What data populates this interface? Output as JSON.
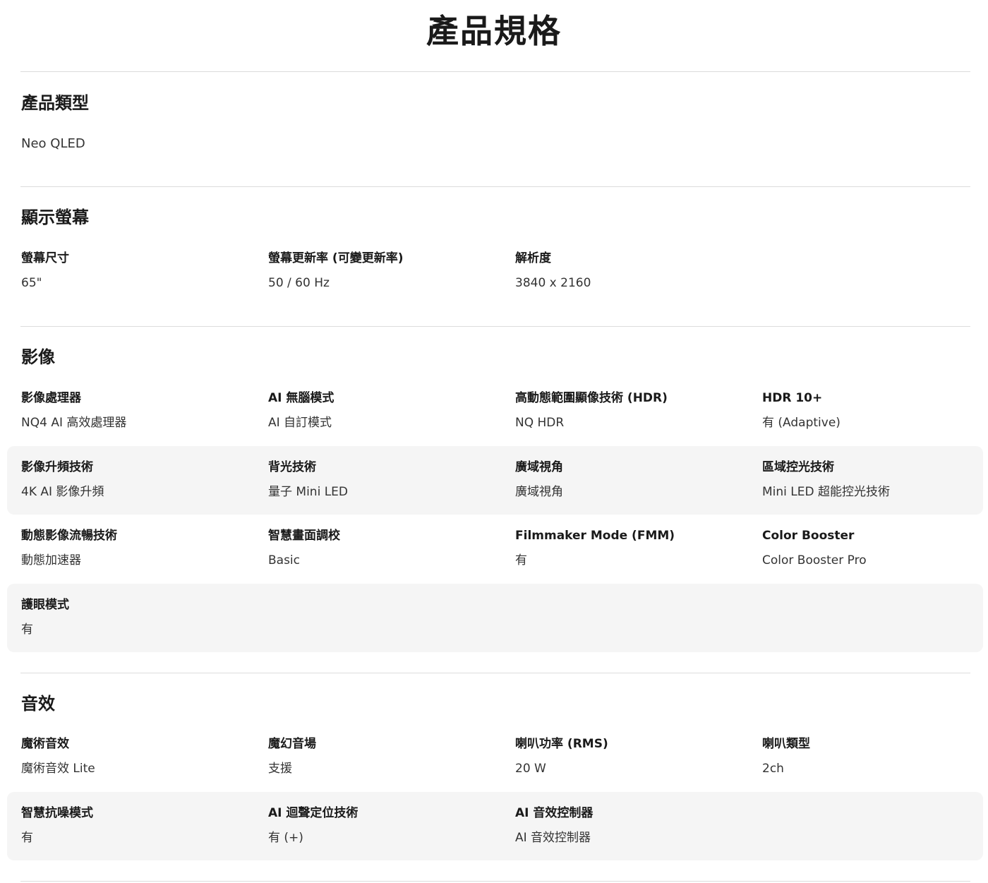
{
  "page_title": "產品規格",
  "product_type": {
    "title": "產品類型",
    "value": "Neo QLED"
  },
  "display": {
    "title": "顯示螢幕",
    "rows": [
      [
        {
          "label": "螢幕尺寸",
          "value": "65\""
        },
        {
          "label": "螢幕更新率 (可變更新率)",
          "value": "50 / 60 Hz"
        },
        {
          "label": "解析度",
          "value": "3840 x 2160"
        }
      ]
    ]
  },
  "video": {
    "title": "影像",
    "rows": [
      [
        {
          "label": "影像處理器",
          "value": "NQ4 AI 高效處理器"
        },
        {
          "label": "AI 無腦模式",
          "value": "AI 自訂模式"
        },
        {
          "label": "高動態範圍顯像技術 (HDR)",
          "value": "NQ HDR"
        },
        {
          "label": "HDR 10+",
          "value": "有 (Adaptive)"
        }
      ],
      [
        {
          "label": "影像升頻技術",
          "value": "4K AI 影像升頻"
        },
        {
          "label": "背光技術",
          "value": "量子 Mini LED"
        },
        {
          "label": "廣域視角",
          "value": "廣域視角"
        },
        {
          "label": "區域控光技術",
          "value": "Mini LED 超能控光技術"
        }
      ],
      [
        {
          "label": "動態影像流暢技術",
          "value": "動態加速器"
        },
        {
          "label": "智慧畫面調校",
          "value": "Basic"
        },
        {
          "label": "Filmmaker Mode (FMM)",
          "value": "有"
        },
        {
          "label": "Color Booster",
          "value": "Color Booster Pro"
        }
      ],
      [
        {
          "label": "護眼模式",
          "value": "有"
        }
      ]
    ]
  },
  "audio": {
    "title": "音效",
    "rows": [
      [
        {
          "label": "魔術音效",
          "value": "魔術音效 Lite"
        },
        {
          "label": "魔幻音場",
          "value": "支援"
        },
        {
          "label": "喇叭功率 (RMS)",
          "value": "20 W"
        },
        {
          "label": "喇叭類型",
          "value": "2ch"
        }
      ],
      [
        {
          "label": "智慧抗噪模式",
          "value": "有"
        },
        {
          "label": "AI 迴聲定位技術",
          "value": "有 (+)"
        },
        {
          "label": "AI 音效控制器",
          "value": "AI 音效控制器"
        }
      ]
    ]
  }
}
